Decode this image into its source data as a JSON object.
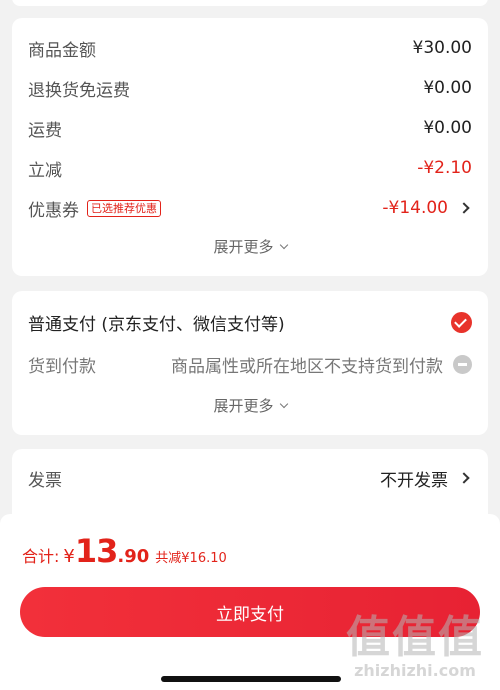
{
  "amounts": {
    "rows": [
      {
        "label": "商品金额",
        "value": "¥30.00"
      },
      {
        "label": "退换货免运费",
        "value": "¥0.00"
      },
      {
        "label": "运费",
        "value": "¥0.00"
      },
      {
        "label": "立减",
        "value": "-¥2.10"
      }
    ],
    "coupon": {
      "label": "优惠券",
      "tag": "已选推荐优惠",
      "value": "-¥14.00"
    },
    "expand_label": "展开更多"
  },
  "payment": {
    "normal_label": "普通支付 (京东支付、微信支付等)",
    "cod_label": "货到付款",
    "cod_note": "商品属性或所在地区不支持货到付款",
    "expand_label": "展开更多"
  },
  "invoice": {
    "label": "发票",
    "value": "不开发票"
  },
  "footer": {
    "total_label": "合计:",
    "currency": "¥",
    "total_int": "13",
    "total_dec": ".90",
    "saved_text": "共减¥16.10",
    "pay_button": "立即支付"
  },
  "watermark": {
    "main": "值值值",
    "sub": "zhizhizhi.com"
  },
  "colors": {
    "accent": "#e2231a",
    "background": "#f2f2f2"
  }
}
